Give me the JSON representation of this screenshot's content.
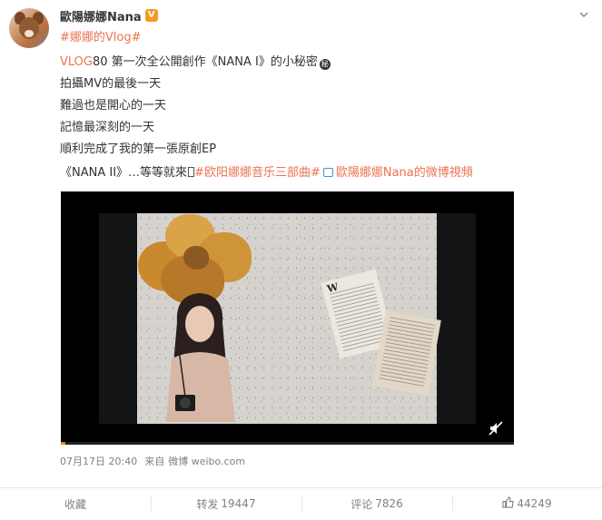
{
  "post": {
    "author": "歐陽娜娜Nana",
    "verified_badge": "V",
    "topic_tag": "#娜娜的Vlog#",
    "line1_tag": "VLOG",
    "line1_num": "80",
    "line1_text": " 第一次全公開創作《NANA I》的小秘密",
    "secret_badge": "秘",
    "line2": "拍攝MV的最後一天",
    "line3": "難過也是開心的一天",
    "line4": "記憶最深刻的一天",
    "line5": "順利完成了我的第一張原創EP",
    "line6_text": "《NANA II》…等等就來",
    "line6_tag": "#欧阳娜娜音乐三部曲#",
    "line6_link": "歐陽娜娜Nana的微博視頻",
    "timestamp": "07月17日 20:40",
    "source_prefix": "来自",
    "source": "微博 weibo.com"
  },
  "video": {
    "progress_fraction": 0.01,
    "accent": "#ff8200"
  },
  "actions": {
    "collect": "收藏",
    "repost_label": "转发",
    "repost_count": "19447",
    "comment_label": "评论",
    "comment_count": "7826",
    "like_count": "44249"
  },
  "icons": [
    "chevron-down-icon",
    "verified-icon",
    "secret-icon",
    "link-icon",
    "mute-icon",
    "thumbs-up-icon"
  ],
  "colors": {
    "tag": "#eb7350",
    "link": "#4a90c8",
    "muted": "#808080"
  }
}
